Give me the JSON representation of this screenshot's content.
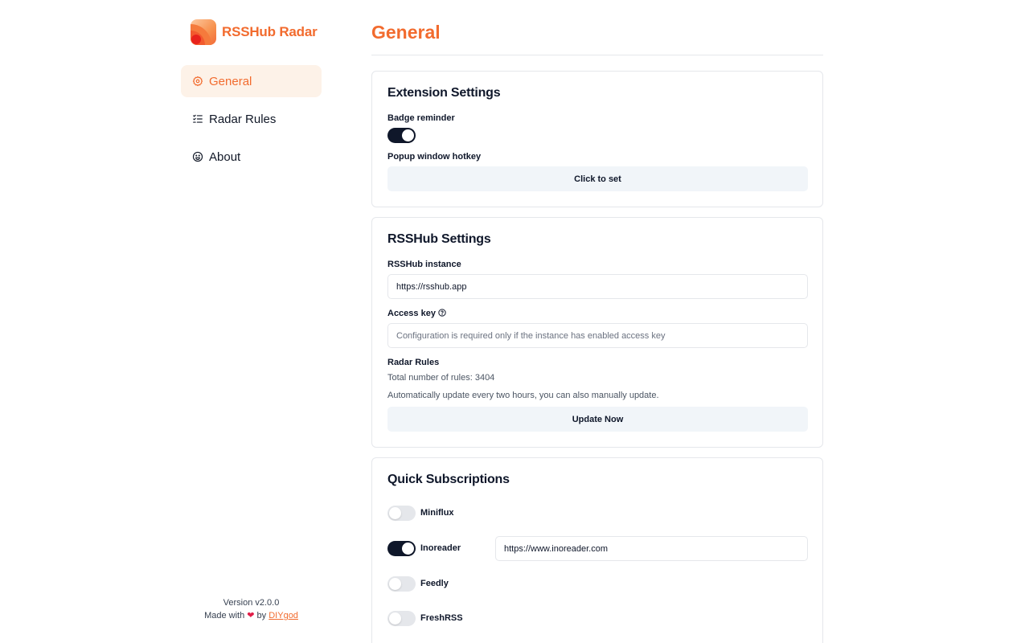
{
  "brand": {
    "name": "RSSHub Radar"
  },
  "sidebar": {
    "items": [
      {
        "label": "General",
        "icon": "gear-icon",
        "active": true
      },
      {
        "label": "Radar Rules",
        "icon": "list-checks-icon",
        "active": false
      },
      {
        "label": "About",
        "icon": "smile-icon",
        "active": false
      }
    ],
    "footer": {
      "version": "Version v2.0.0",
      "made_with": "Made with",
      "by": "by",
      "author": "DIYgod"
    }
  },
  "page": {
    "title": "General"
  },
  "extension_settings": {
    "title": "Extension Settings",
    "badge_label": "Badge reminder",
    "badge_enabled": true,
    "hotkey_label": "Popup window hotkey",
    "hotkey_button": "Click to set"
  },
  "rsshub_settings": {
    "title": "RSSHub Settings",
    "instance_label": "RSSHub instance",
    "instance_value": "https://rsshub.app",
    "access_key_label": "Access key",
    "access_key_placeholder": "Configuration is required only if the instance has enabled access key",
    "rules_label": "Radar Rules",
    "rules_total": "Total number of rules: 3404",
    "rules_note": "Automatically update every two hours, you can also manually update.",
    "update_button": "Update Now"
  },
  "quick_subscriptions": {
    "title": "Quick Subscriptions",
    "items": [
      {
        "name": "Miniflux",
        "enabled": false
      },
      {
        "name": "Inoreader",
        "enabled": true,
        "url": "https://www.inoreader.com"
      },
      {
        "name": "Feedly",
        "enabled": false
      },
      {
        "name": "FreshRSS",
        "enabled": false
      }
    ]
  },
  "colors": {
    "accent": "#f26b2e",
    "active_bg": "#fdf2e8",
    "toggle_on": "#0f172a",
    "toggle_off": "#e5e7eb"
  }
}
